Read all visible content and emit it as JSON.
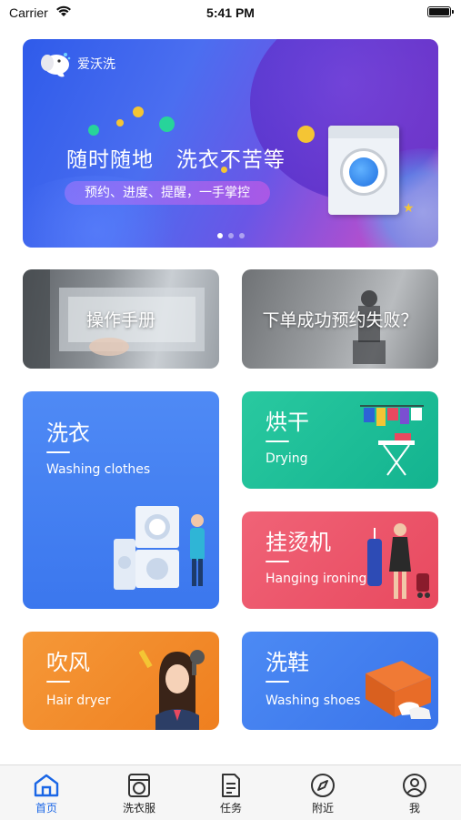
{
  "status_bar": {
    "carrier": "Carrier",
    "time": "5:41 PM"
  },
  "banner": {
    "logo_text": "爱沃洗",
    "headline": "随时随地   洗衣不苦等",
    "subline": "预约、进度、提醒，一手掌控",
    "pager_count": 3,
    "pager_active": 0
  },
  "photo_cards": [
    {
      "label": "操作手册"
    },
    {
      "label": "下单成功预约失败？"
    }
  ],
  "services": {
    "washing": {
      "title": "洗衣",
      "subtitle": "Washing clothes",
      "color": "#4284f2"
    },
    "drying": {
      "title": "烘干",
      "subtitle": "Drying",
      "color": "#1fbf98"
    },
    "ironing": {
      "title": "挂烫机",
      "subtitle": "Hanging ironing",
      "color": "#ec5569"
    },
    "hair_dryer": {
      "title": "吹风",
      "subtitle": "Hair dryer",
      "color": "#f28a2a"
    },
    "shoes": {
      "title": "洗鞋",
      "subtitle": "Washing shoes",
      "color": "#4282f0"
    }
  },
  "tabbar": {
    "active_color": "#1a66e6",
    "items": [
      {
        "label": "首页",
        "icon": "home-icon",
        "active": true
      },
      {
        "label": "洗衣服",
        "icon": "washer-icon",
        "active": false
      },
      {
        "label": "任务",
        "icon": "document-icon",
        "active": false
      },
      {
        "label": "附近",
        "icon": "compass-icon",
        "active": false
      },
      {
        "label": "我",
        "icon": "profile-icon",
        "active": false
      }
    ]
  }
}
